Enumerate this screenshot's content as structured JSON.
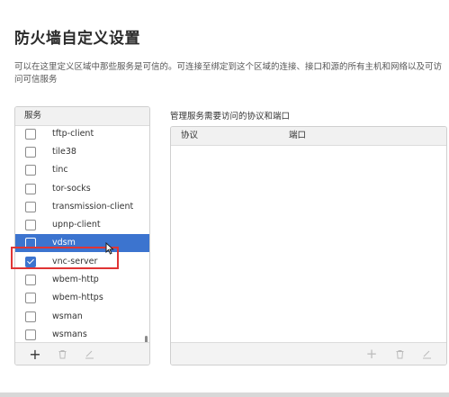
{
  "page": {
    "title": "防火墙自定义设置",
    "description": "可以在这里定义区域中那些服务是可信的。可连接至绑定到这个区域的连接、接口和源的所有主机和网络以及可访问可信服务"
  },
  "services_panel": {
    "header": "服务",
    "items": [
      {
        "label": "tftp-client",
        "checked": false,
        "selected": false
      },
      {
        "label": "tile38",
        "checked": false,
        "selected": false
      },
      {
        "label": "tinc",
        "checked": false,
        "selected": false
      },
      {
        "label": "tor-socks",
        "checked": false,
        "selected": false
      },
      {
        "label": "transmission-client",
        "checked": false,
        "selected": false
      },
      {
        "label": "upnp-client",
        "checked": false,
        "selected": false
      },
      {
        "label": "vdsm",
        "checked": false,
        "selected": true
      },
      {
        "label": "vnc-server",
        "checked": true,
        "selected": false
      },
      {
        "label": "wbem-http",
        "checked": false,
        "selected": false
      },
      {
        "label": "wbem-https",
        "checked": false,
        "selected": false
      },
      {
        "label": "wsman",
        "checked": false,
        "selected": false
      },
      {
        "label": "wsmans",
        "checked": false,
        "selected": false
      }
    ],
    "toolbar": {
      "add": "+",
      "delete": "🗑",
      "edit": "∠"
    }
  },
  "ports_panel": {
    "label": "管理服务需要访问的协议和端口",
    "columns": {
      "protocol": "协议",
      "port": "端口"
    },
    "toolbar": {
      "add": "+",
      "delete": "🗑",
      "edit": "∠"
    }
  },
  "colors": {
    "selection": "#3c74cf",
    "highlight": "#e03434"
  }
}
